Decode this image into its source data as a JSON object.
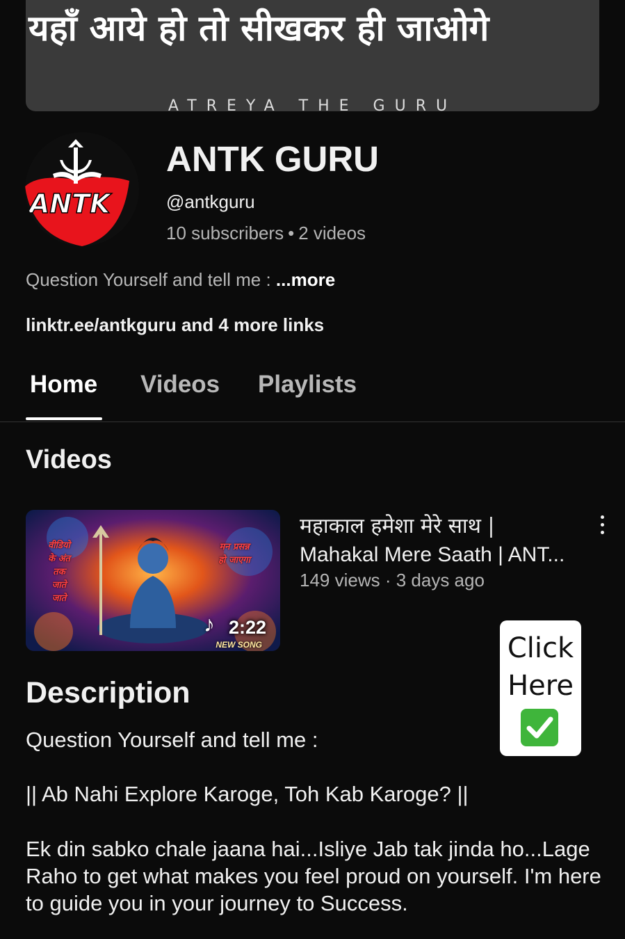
{
  "banner": {
    "headline": "यहाँ आये हो तो सीखकर ही जाओगे",
    "subtitle": "ATREYA THE GURU"
  },
  "channel": {
    "avatar_text": "ANTK",
    "name": "ANTK GURU",
    "handle": "@antkguru",
    "subscribers": "10 subscribers",
    "videos_count": "2 videos",
    "about_text": "Question Yourself and tell me :",
    "about_more": "...more",
    "links_text": "linktr.ee/antkguru and 4 more links"
  },
  "tabs": [
    {
      "label": "Home",
      "active": true
    },
    {
      "label": "Videos",
      "active": false
    },
    {
      "label": "Playlists",
      "active": false
    }
  ],
  "videos_section": {
    "title": "Videos",
    "items": [
      {
        "title_line1": "महाकाल हमेशा मेरे साथ |",
        "title_line2": "Mahakal Mere Saath | ANT...",
        "meta": "149 views · 3 days ago",
        "duration": "2:22",
        "thumb_left_text": "वीडियो के अंत तक जाते जाते",
        "thumb_right_text": "मन प्रसन्न हो जाएगा",
        "thumb_badge": "NEW SONG"
      }
    ]
  },
  "overlay_card": {
    "line1": "Click",
    "line2": "Here",
    "icon": "check-mark-icon"
  },
  "description": {
    "title": "Description",
    "p1": "Question Yourself and tell me :",
    "p2": "|| Ab Nahi Explore Karoge, Toh Kab Karoge? ||",
    "p3": "Ek din sabko chale jaana hai...Isliye Jab tak jinda ho...Lage Raho to get what makes you feel proud on yourself. I'm here to guide you in your journey to Success."
  },
  "colors": {
    "background": "#0b0b0b",
    "avatar_red": "#e8141c",
    "check_green": "#3fb53b"
  }
}
